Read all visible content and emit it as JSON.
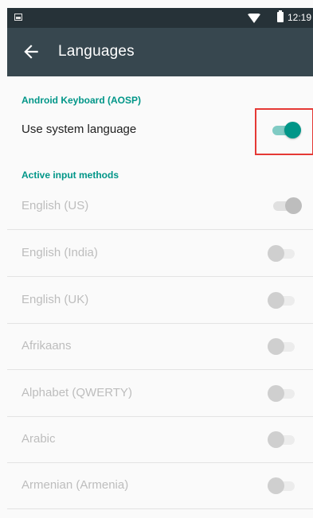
{
  "status_bar": {
    "time": "12:19",
    "icons": [
      "notification-image-icon",
      "wifi-icon",
      "battery-icon"
    ]
  },
  "app_bar": {
    "back_icon": "arrow-back-icon",
    "title": "Languages"
  },
  "keyboard_section": {
    "header": "Android Keyboard (AOSP)",
    "use_system_language": {
      "label": "Use system language",
      "checked": true
    }
  },
  "input_methods_section": {
    "header": "Active input methods",
    "items": [
      {
        "label": "English (US)",
        "checked": true,
        "enabled": false
      },
      {
        "label": "English (India)",
        "checked": false,
        "enabled": false
      },
      {
        "label": "English (UK)",
        "checked": false,
        "enabled": false
      },
      {
        "label": "Afrikaans",
        "checked": false,
        "enabled": false
      },
      {
        "label": "Alphabet (QWERTY)",
        "checked": false,
        "enabled": false
      },
      {
        "label": "Arabic",
        "checked": false,
        "enabled": false
      },
      {
        "label": "Armenian (Armenia)",
        "checked": false,
        "enabled": false
      }
    ]
  },
  "colors": {
    "accent": "#009688",
    "app_bar": "#37474f",
    "status_bar": "#263238",
    "highlight": "#e53935"
  }
}
